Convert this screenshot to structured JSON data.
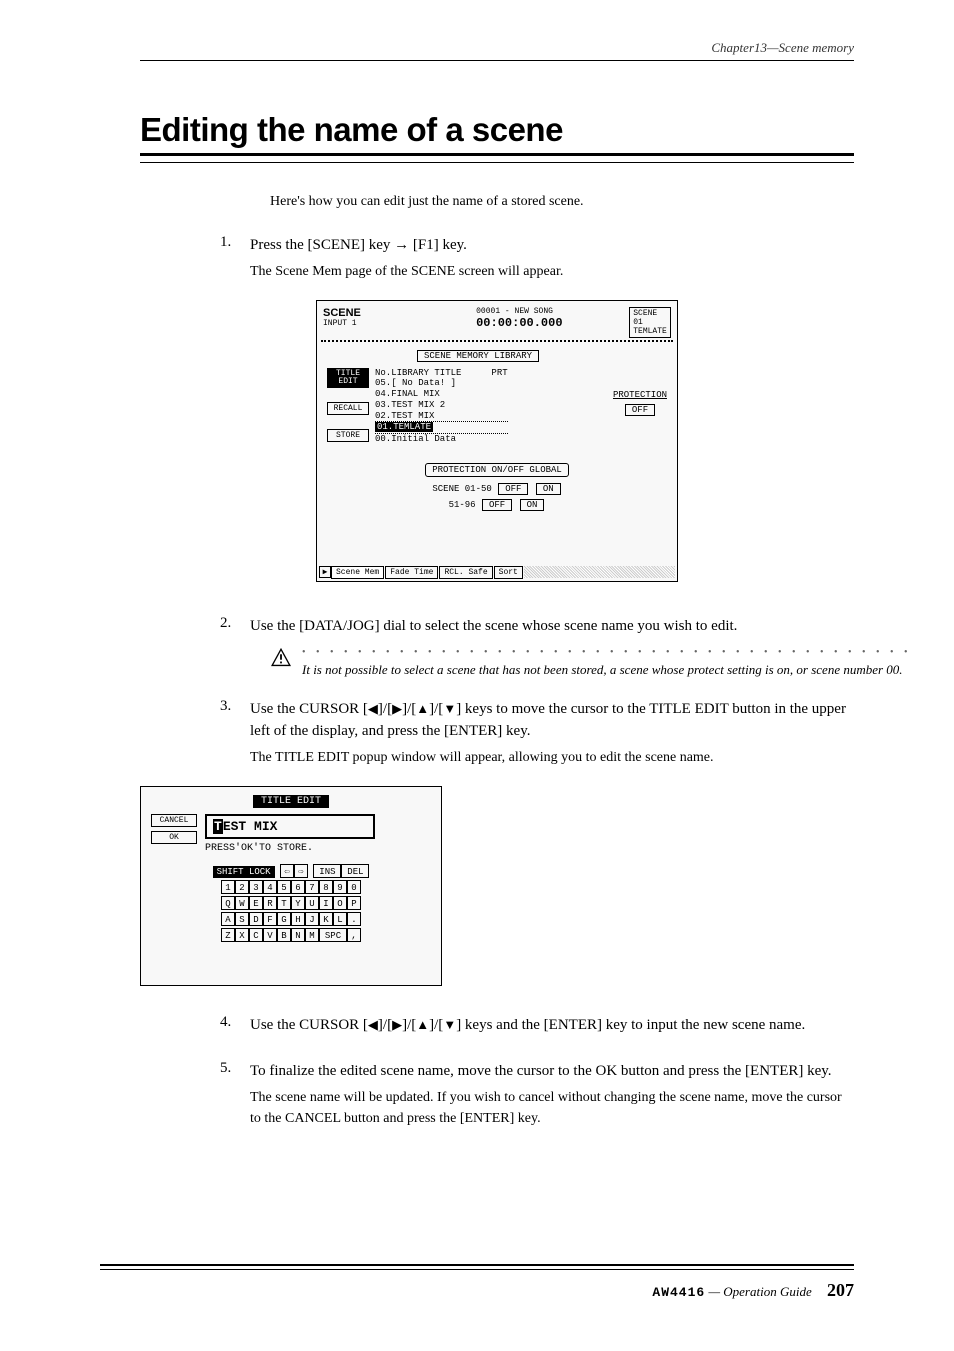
{
  "header": {
    "chapter": "Chapter13—Scene memory"
  },
  "title": "Editing the name of a scene",
  "intro": "Here's how you can edit just the name of a stored scene.",
  "steps": {
    "s1": {
      "num": "1.",
      "head": "Press the [SCENE] key → [F1] key.",
      "body": "The Scene Mem page of the SCENE screen will appear."
    },
    "s2": {
      "num": "2.",
      "head": "Use the [DATA/JOG] dial to select the scene whose scene name you wish to edit."
    },
    "s3": {
      "num": "3.",
      "head_a": "Use the CURSOR [",
      "head_b": "]/[",
      "head_c": "]/[",
      "head_d": "]/[",
      "head_e": "] keys to move the cursor to the TITLE EDIT button in the upper left of the display, and press the [ENTER] key.",
      "body": "The TITLE EDIT popup window will appear, allowing you to edit the scene name."
    },
    "s4": {
      "num": "4.",
      "head_a": "Use the CURSOR [",
      "head_b": "]/[",
      "head_c": "]/[",
      "head_d": "]/[",
      "head_e": "] keys and the [ENTER] key to input the new scene name."
    },
    "s5": {
      "num": "5.",
      "head": "To finalize the edited scene name, move the cursor to the OK button and press the [ENTER] key.",
      "body": "The scene name will be updated. If you wish to cancel without changing the scene name, move the cursor to the CANCEL button and press the [ENTER] key."
    }
  },
  "caution": {
    "text": "It is not possible to select a scene that has not been stored, a scene whose protect setting is on, or scene number 00."
  },
  "screen1": {
    "topLabel": "SCENE",
    "inputLabel": "INPUT 1",
    "songInfo": "00001 - NEW SONG",
    "time": "00:00:00.000",
    "sceneNum": "SCENE 01",
    "sceneName": "TEMLATE",
    "libTitle": "SCENE MEMORY LIBRARY",
    "listHeader": "No.LIBRARY TITLE",
    "prtHeader": "PRT",
    "item5": "05.[   No Data!   ]",
    "item4": "04.FINAL MIX",
    "item3": "03.TEST MIX 2",
    "item2": "02.TEST MIX",
    "item1": "01.TEMLATE",
    "item0": "00.Initial Data",
    "protection": "PROTECTION",
    "off": "OFF",
    "btnTitleEdit": "TITLE\nEDIT",
    "btnRecall": "RECALL",
    "btnStore": "STORE",
    "protSection": "PROTECTION ON/OFF GLOBAL",
    "range1": "SCENE 01-50",
    "range2": "51-96",
    "btnOff": "OFF",
    "btnOn": "ON",
    "tab1": "Scene Mem",
    "tab2": "Fade Time",
    "tab3": "RCL. Safe",
    "tab4": "Sort"
  },
  "screen2": {
    "title": "TITLE EDIT",
    "cancel": "CANCEL",
    "ok": "OK",
    "inputCursor": "T",
    "inputRest": "EST MIX",
    "hint": "PRESS'OK'TO STORE.",
    "shiftLock": "SHIFT LOCK",
    "ins": "INS",
    "del": "DEL",
    "row1": "1234567890",
    "row2": "QWERTYUIOP",
    "row3": "ASDFGHJKL.",
    "row4a": "ZXCVBNM",
    "spc": "SPC",
    "comma": ","
  },
  "footer": {
    "model": "AW4416",
    "guide": " — Operation Guide",
    "page": "207"
  }
}
